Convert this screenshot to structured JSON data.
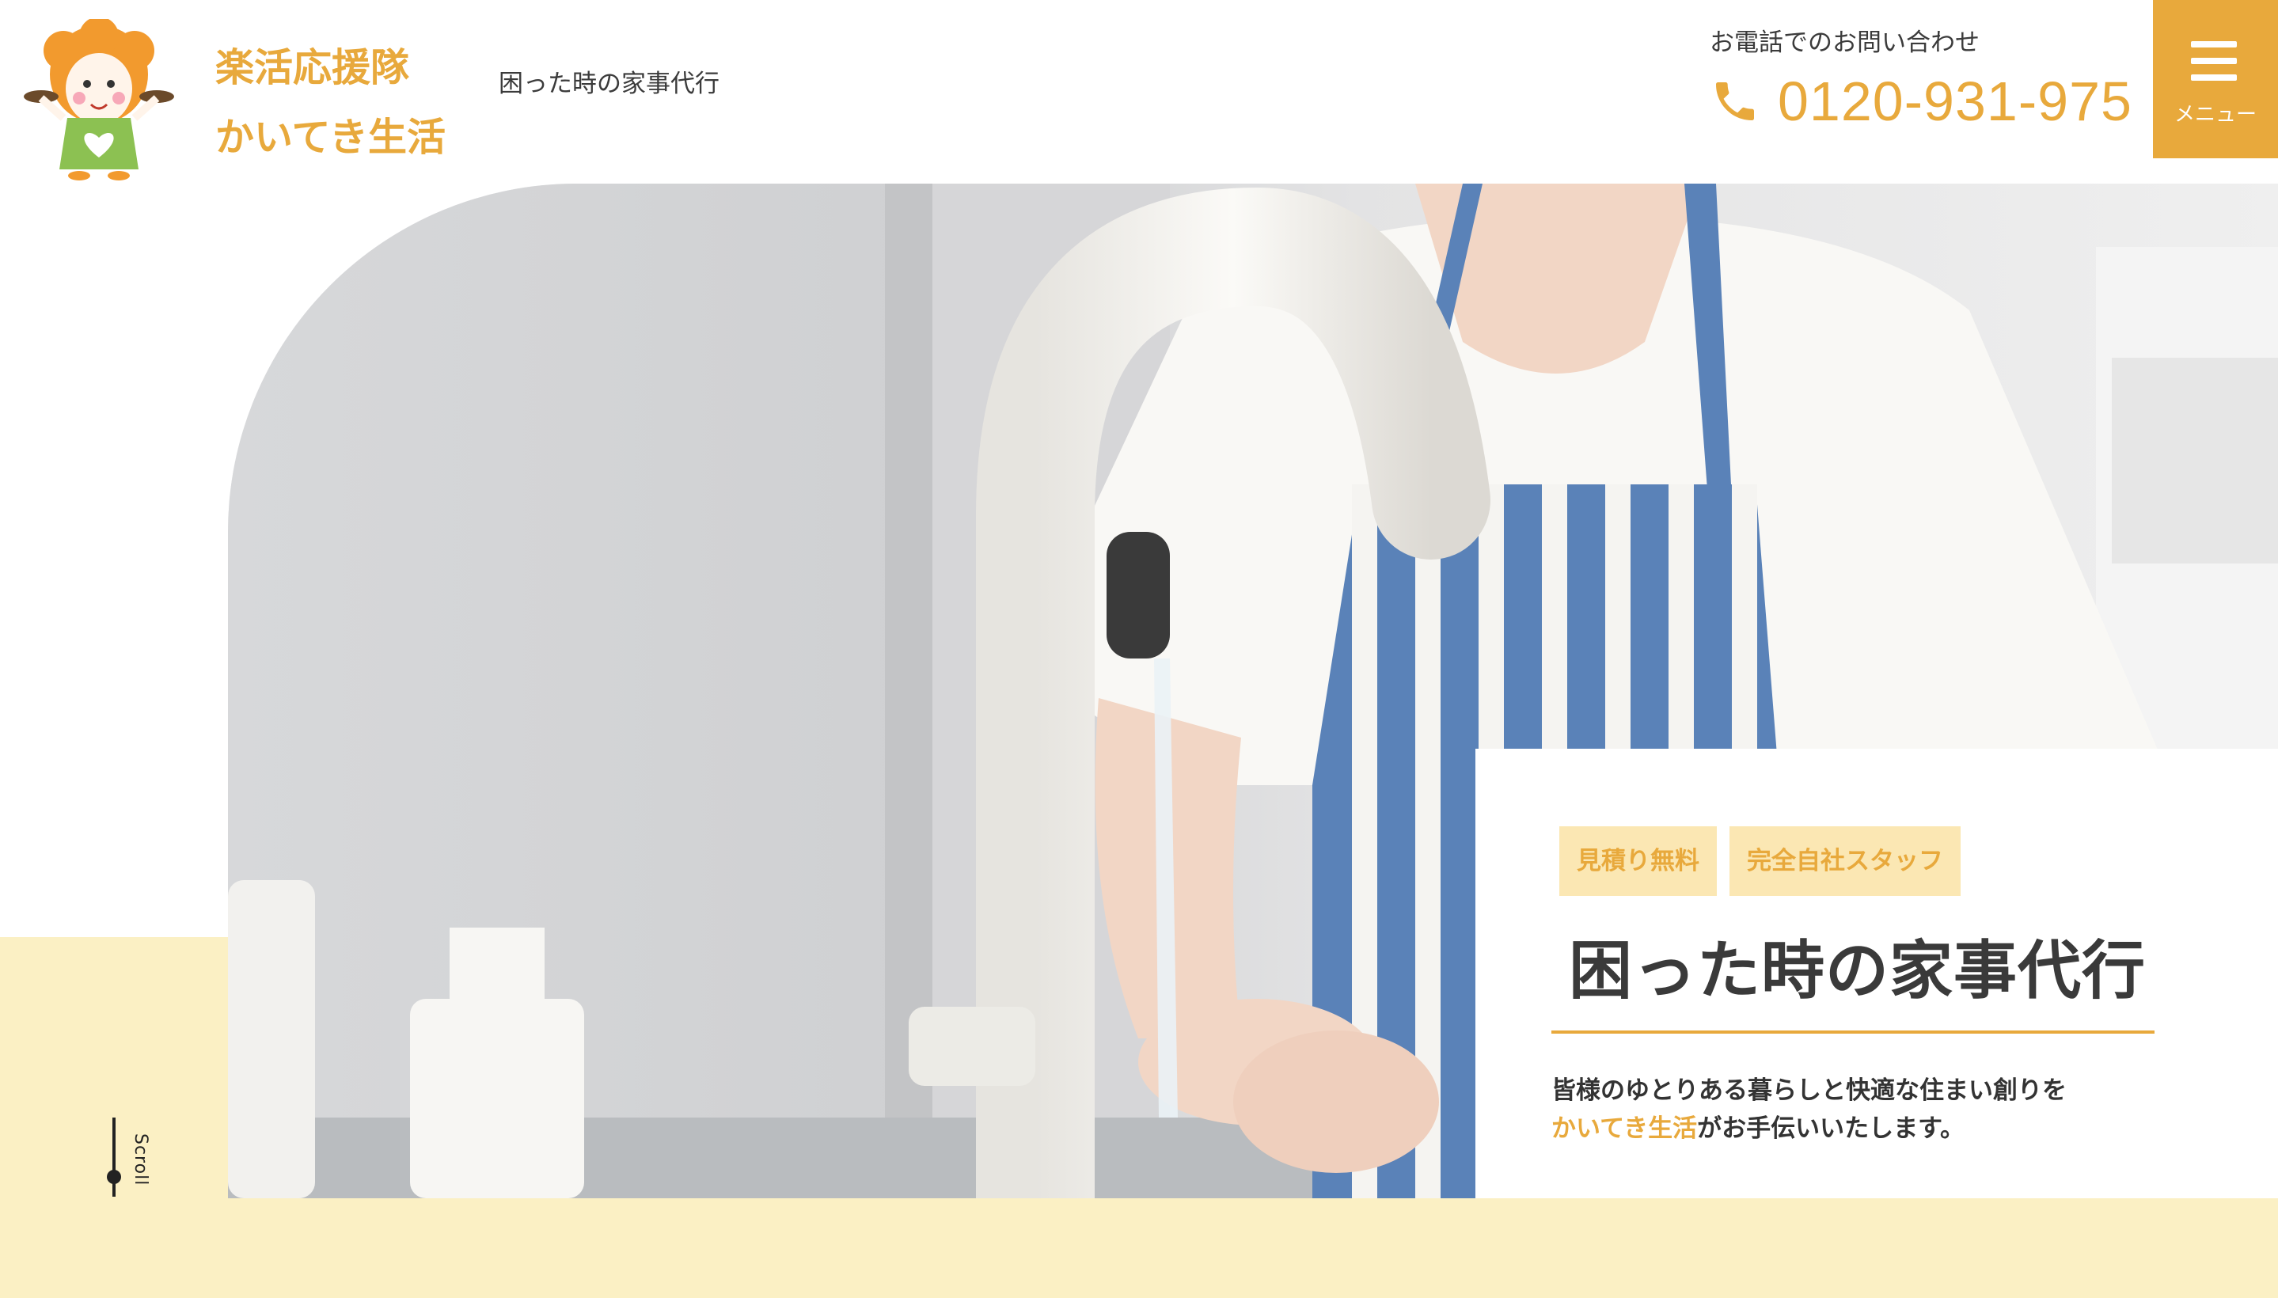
{
  "header": {
    "brand_line1": "楽活応援隊",
    "brand_line2": "かいてき生活",
    "tagline": "困った時の家事代行",
    "contact_label": "お電話でのお問い合わせ",
    "phone_number": "0120-931-975",
    "menu_label": "メニュー"
  },
  "hero": {
    "scroll_label": "Scroll",
    "badges": [
      "見積り無料",
      "完全自社スタッフ"
    ],
    "title": "困った時の家事代行",
    "desc_line1": "皆様のゆとりある暮らしと快適な住まい創りを",
    "desc_highlight": "かいてき生活",
    "desc_line2_rest": "がお手伝いいたします。"
  },
  "colors": {
    "accent": "#e8a93c",
    "badge_bg": "#fbe7b3",
    "light_yellow": "#fbf0c4",
    "text": "#333333"
  },
  "icons": [
    "mascot-logo",
    "phone-icon",
    "menu-icon"
  ]
}
